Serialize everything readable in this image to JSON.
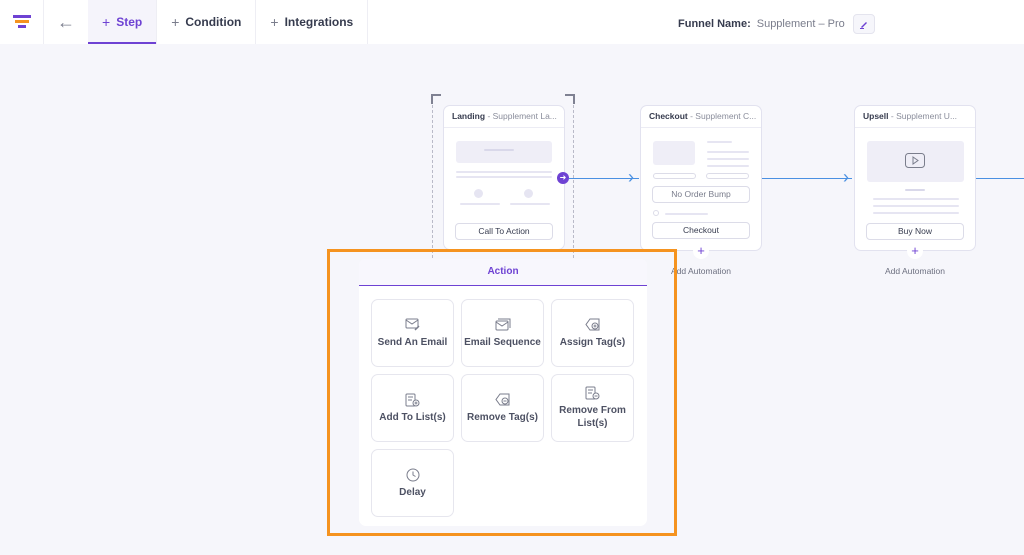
{
  "topbar": {
    "tabs": [
      {
        "label": "Step",
        "active": true
      },
      {
        "label": "Condition",
        "active": false
      },
      {
        "label": "Integrations",
        "active": false
      }
    ],
    "funnel_name_label": "Funnel Name:",
    "funnel_name_value": "Supplement – Pro"
  },
  "steps": [
    {
      "type": "Landing",
      "name": "- Supplement La...",
      "button": "Call To Action"
    },
    {
      "type": "Checkout",
      "name": "- Supplement C...",
      "bump": "No Order Bump",
      "button": "Checkout",
      "add_label": "Add Automation"
    },
    {
      "type": "Upsell",
      "name": "- Supplement U...",
      "button": "Buy Now",
      "add_label": "Add Automation"
    }
  ],
  "action_panel": {
    "title": "Action",
    "items": [
      {
        "label": "Send An Email",
        "icon": "send-email-icon"
      },
      {
        "label": "Email Sequence",
        "icon": "email-sequence-icon"
      },
      {
        "label": "Assign Tag(s)",
        "icon": "assign-tag-icon"
      },
      {
        "label": "Add To List(s)",
        "icon": "add-list-icon"
      },
      {
        "label": "Remove Tag(s)",
        "icon": "remove-tag-icon"
      },
      {
        "label": "Remove From List(s)",
        "icon": "remove-list-icon"
      },
      {
        "label": "Delay",
        "icon": "clock-icon"
      }
    ]
  },
  "colors": {
    "accent": "#6e42d3",
    "connector": "#4a90e2",
    "highlight": "#f5931f"
  }
}
